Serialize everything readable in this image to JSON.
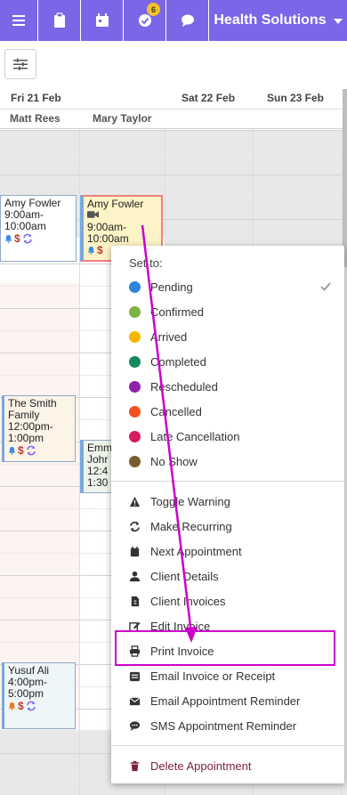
{
  "topnav": {
    "icons": [
      "menu-icon",
      "clipboard-icon",
      "calendar-icon",
      "check-circle-icon",
      "chat-icon"
    ],
    "task_badge": "6",
    "org_name": "Health Solutions",
    "bg_color": "#7b66e8"
  },
  "calendar": {
    "columns": [
      {
        "date": "Fri 21 Feb",
        "staff": "Matt Rees"
      },
      {
        "date": "",
        "staff": "Mary Taylor"
      },
      {
        "date": "Sat 22 Feb",
        "staff": ""
      },
      {
        "date": "Sun 23 Feb",
        "staff": ""
      }
    ],
    "appointments": [
      {
        "name": "Amy Fowler",
        "time_start": "9:00am-",
        "time_end": "10:00am",
        "icons": [
          "bell-icon",
          "dollar-icon",
          "recurring-icon"
        ]
      },
      {
        "name": "Amy Fowler",
        "time_start": "9:00am-",
        "time_end": "10:00am",
        "icons": [
          "video-icon",
          "bell-icon",
          "dollar-icon"
        ]
      },
      {
        "name": "The Smith",
        "name2": "Family",
        "time_start": "12:00pm-",
        "time_end": "1:00pm",
        "icons": [
          "bell-icon",
          "dollar-icon",
          "recurring-icon"
        ]
      },
      {
        "name": "Emm",
        "name2": "Johr",
        "time_start": "12:4",
        "time_end": "1:30",
        "icons": []
      },
      {
        "name": "Yusuf Ali",
        "time_start": "4:00pm-",
        "time_end": "5:00pm",
        "icons": [
          "bell-icon",
          "dollar-icon",
          "recurring-icon"
        ]
      }
    ]
  },
  "context_menu": {
    "heading": "Set to:",
    "statuses": [
      {
        "label": "Pending",
        "color": "#2e86de",
        "selected": true
      },
      {
        "label": "Confirmed",
        "color": "#7cb342"
      },
      {
        "label": "Arrived",
        "color": "#f9b500"
      },
      {
        "label": "Completed",
        "color": "#138a5a"
      },
      {
        "label": "Rescheduled",
        "color": "#8e24aa"
      },
      {
        "label": "Cancelled",
        "color": "#f4511e"
      },
      {
        "label": "Late Cancellation",
        "color": "#d81b60"
      },
      {
        "label": "No Show",
        "color": "#7a5c2e"
      }
    ],
    "actions": [
      {
        "label": "Toggle Warning",
        "icon": "warning-icon"
      },
      {
        "label": "Make Recurring",
        "icon": "recurring-icon"
      },
      {
        "label": "Next Appointment",
        "icon": "calendar-icon"
      },
      {
        "label": "Client Details",
        "icon": "user-icon"
      },
      {
        "label": "Client Invoices",
        "icon": "invoice-icon"
      },
      {
        "label": "Edit Invoice",
        "icon": "edit-icon"
      },
      {
        "label": "Print Invoice",
        "icon": "printer-icon"
      },
      {
        "label": "Email Invoice or Receipt",
        "icon": "email-receipt-icon"
      },
      {
        "label": "Email Appointment Reminder",
        "icon": "envelope-icon"
      },
      {
        "label": "SMS Appointment Reminder",
        "icon": "sms-icon"
      }
    ],
    "delete_label": "Delete Appointment"
  },
  "annotation": {
    "highlighted_item": "Print Invoice",
    "color": "#cc00cc"
  }
}
